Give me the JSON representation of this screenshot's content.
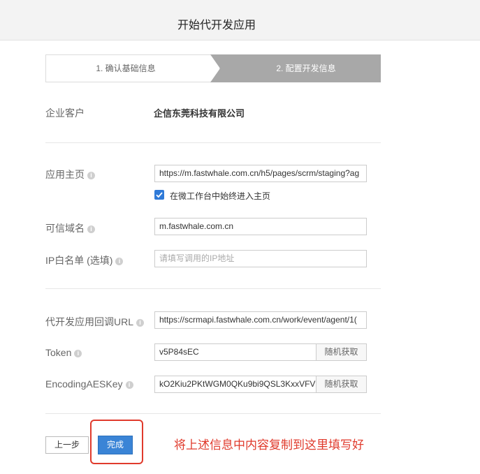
{
  "header": {
    "title": "开始代开发应用"
  },
  "steps": [
    {
      "label": "1. 确认基础信息"
    },
    {
      "label": "2. 配置开发信息"
    }
  ],
  "enterprise": {
    "label": "企业客户",
    "value": "企信东莞科技有限公司"
  },
  "homepage": {
    "label": "应用主页",
    "value": "https://m.fastwhale.com.cn/h5/pages/scrm/staging?ag",
    "checkbox_label": "在微工作台中始终进入主页",
    "checked": true
  },
  "trusted_domain": {
    "label": "可信域名",
    "value": "m.fastwhale.com.cn"
  },
  "ip_whitelist": {
    "label": "IP白名单 (选填)",
    "placeholder": "请填写调用的IP地址"
  },
  "callback_url": {
    "label": "代开发应用回调URL",
    "value": "https://scrmapi.fastwhale.com.cn/work/event/agent/1("
  },
  "token": {
    "label": "Token",
    "value": "v5P84sEC",
    "random_button": "随机获取"
  },
  "aes_key": {
    "label": "EncodingAESKey",
    "value": "kO2Kiu2PKtWGM0QKu9bi9QSL3KxxVFV",
    "random_button": "随机获取"
  },
  "footer": {
    "prev_label": "上一步",
    "done_label": "完成"
  },
  "annotation": {
    "text": "将上述信息中内容复制到这里填写好",
    "color": "#e03a2c"
  },
  "icons": {
    "info": "info-icon",
    "check": "check-icon"
  },
  "colors": {
    "primary": "#3a84d6",
    "step_active": "#a8a8a8",
    "annotation": "#e03a2c"
  }
}
